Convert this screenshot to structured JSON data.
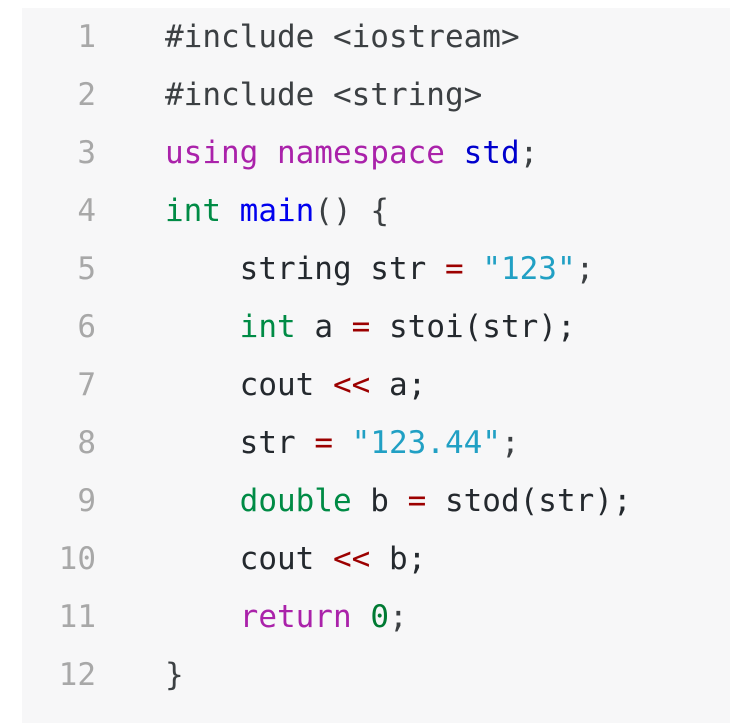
{
  "editor": {
    "language": "cpp",
    "background": "#f7f7f8",
    "page_background": "#ffffff",
    "gutter_color": "#a8a8a8",
    "colors": {
      "keyword": "#aa22aa",
      "type": "#008b45",
      "namespace": "#0000cd",
      "function": "#0000ee",
      "string": "#21a0c4",
      "number": "#007a33",
      "operator": "#9c0000",
      "plain": "#24292e",
      "preprocessor": "#3c4043"
    },
    "line_numbers": [
      "1",
      "2",
      "3",
      "4",
      "5",
      "6",
      "7",
      "8",
      "9",
      "10",
      "11",
      "12"
    ],
    "lines": [
      {
        "number": "1",
        "indent": 0,
        "text": "#include <iostream>",
        "tokens": [
          {
            "t": "#include <iostream>",
            "c": "t-pre"
          }
        ]
      },
      {
        "number": "2",
        "indent": 0,
        "text": "#include <string>",
        "tokens": [
          {
            "t": "#include <string>",
            "c": "t-pre"
          }
        ]
      },
      {
        "number": "3",
        "indent": 0,
        "text": "using namespace std;",
        "tokens": [
          {
            "t": "using namespace ",
            "c": "t-kw"
          },
          {
            "t": "std",
            "c": "t-ns"
          },
          {
            "t": ";",
            "c": "t-punct"
          }
        ]
      },
      {
        "number": "4",
        "indent": 0,
        "text": "int main() {",
        "tokens": [
          {
            "t": "int",
            "c": "t-type"
          },
          {
            "t": " ",
            "c": "t-plain"
          },
          {
            "t": "main",
            "c": "t-fn"
          },
          {
            "t": "() {",
            "c": "t-punct"
          }
        ]
      },
      {
        "number": "5",
        "indent": 4,
        "text": "    string str = \"123\";",
        "tokens": [
          {
            "t": "    string str ",
            "c": "t-plain"
          },
          {
            "t": "=",
            "c": "t-op"
          },
          {
            "t": " ",
            "c": "t-plain"
          },
          {
            "t": "\"123\"",
            "c": "t-str"
          },
          {
            "t": ";",
            "c": "t-punct"
          }
        ]
      },
      {
        "number": "6",
        "indent": 4,
        "text": "    int a = stoi(str);",
        "tokens": [
          {
            "t": "    ",
            "c": "t-plain"
          },
          {
            "t": "int",
            "c": "t-type"
          },
          {
            "t": " a ",
            "c": "t-plain"
          },
          {
            "t": "=",
            "c": "t-op"
          },
          {
            "t": " stoi(str);",
            "c": "t-plain"
          }
        ]
      },
      {
        "number": "7",
        "indent": 4,
        "text": "    cout << a;",
        "tokens": [
          {
            "t": "    cout ",
            "c": "t-plain"
          },
          {
            "t": "<<",
            "c": "t-op"
          },
          {
            "t": " a;",
            "c": "t-plain"
          }
        ]
      },
      {
        "number": "8",
        "indent": 4,
        "text": "    str = \"123.44\";",
        "tokens": [
          {
            "t": "    str ",
            "c": "t-plain"
          },
          {
            "t": "=",
            "c": "t-op"
          },
          {
            "t": " ",
            "c": "t-plain"
          },
          {
            "t": "\"123.44\"",
            "c": "t-str"
          },
          {
            "t": ";",
            "c": "t-punct"
          }
        ]
      },
      {
        "number": "9",
        "indent": 4,
        "text": "    double b = stod(str);",
        "tokens": [
          {
            "t": "    ",
            "c": "t-plain"
          },
          {
            "t": "double",
            "c": "t-type"
          },
          {
            "t": " b ",
            "c": "t-plain"
          },
          {
            "t": "=",
            "c": "t-op"
          },
          {
            "t": " stod(str);",
            "c": "t-plain"
          }
        ]
      },
      {
        "number": "10",
        "indent": 4,
        "text": "    cout << b;",
        "tokens": [
          {
            "t": "    cout ",
            "c": "t-plain"
          },
          {
            "t": "<<",
            "c": "t-op"
          },
          {
            "t": " b;",
            "c": "t-plain"
          }
        ]
      },
      {
        "number": "11",
        "indent": 4,
        "text": "    return 0;",
        "tokens": [
          {
            "t": "    ",
            "c": "t-plain"
          },
          {
            "t": "return",
            "c": "t-kw"
          },
          {
            "t": " ",
            "c": "t-plain"
          },
          {
            "t": "0",
            "c": "t-num"
          },
          {
            "t": ";",
            "c": "t-punct"
          }
        ]
      },
      {
        "number": "12",
        "indent": 0,
        "text": "}",
        "tokens": [
          {
            "t": "}",
            "c": "t-punct"
          }
        ]
      }
    ]
  }
}
